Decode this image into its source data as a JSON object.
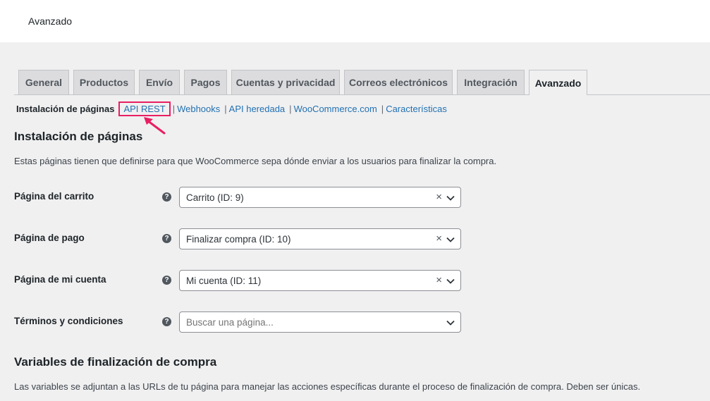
{
  "header": {
    "title": "Avanzado"
  },
  "tabs": [
    {
      "label": "General"
    },
    {
      "label": "Productos"
    },
    {
      "label": "Envío"
    },
    {
      "label": "Pagos"
    },
    {
      "label": "Cuentas y privacidad"
    },
    {
      "label": "Correos electrónicos"
    },
    {
      "label": "Integración"
    },
    {
      "label": "Avanzado",
      "active": true
    }
  ],
  "subnav": {
    "current": "Instalación de páginas",
    "links": [
      "API REST",
      "Webhooks",
      "API heredada",
      "WooCommerce.com",
      "Características"
    ],
    "separator": "|"
  },
  "annotation": {
    "highlight_color": "#e91e63",
    "highlighted_link": "API REST"
  },
  "page_setup": {
    "title": "Instalación de páginas",
    "description": "Estas páginas tienen que definirse para que WooCommerce sepa dónde enviar a los usuarios para finalizar la compra.",
    "rows": [
      {
        "label": "Página del carrito",
        "value": "Carrito (ID: 9)",
        "clearable": true
      },
      {
        "label": "Página de pago",
        "value": "Finalizar compra (ID: 10)",
        "clearable": true
      },
      {
        "label": "Página de mi cuenta",
        "value": "Mi cuenta (ID: 11)",
        "clearable": true
      },
      {
        "label": "Términos y condiciones",
        "placeholder": "Buscar una página...",
        "clearable": false
      }
    ],
    "help_glyph": "?",
    "clear_glyph": "×"
  },
  "checkout_endpoints": {
    "title": "Variables de finalización de compra",
    "description": "Las variables se adjuntan a las URLs de tu página para manejar las acciones específicas durante el proceso de finalización de compra. Deben ser únicas."
  },
  "colors": {
    "background": "#f0f0f1",
    "link": "#2271b1",
    "text": "#1d2327"
  }
}
